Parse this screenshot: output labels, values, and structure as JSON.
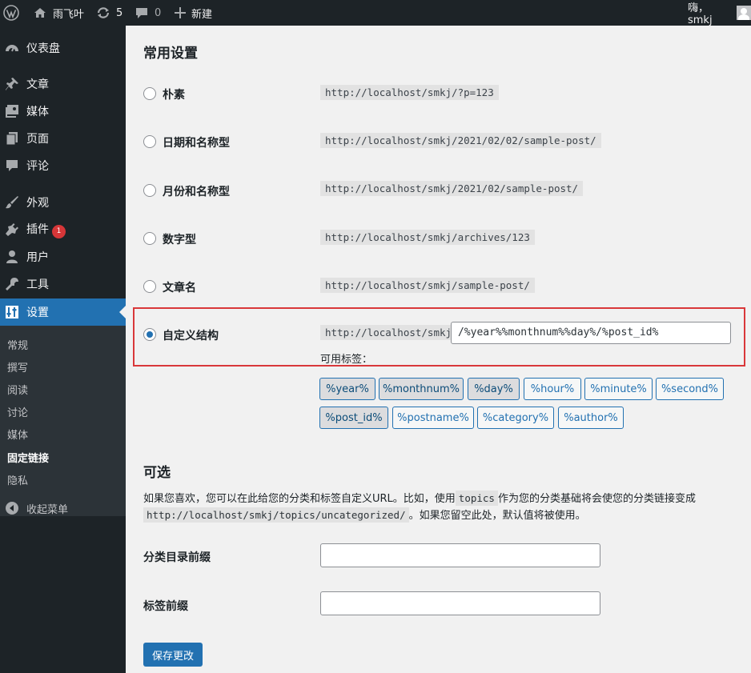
{
  "adminbar": {
    "site_name": "雨飞叶",
    "updates_count": "5",
    "comments_count": "0",
    "new_label": "新建",
    "greeting": "嗨，smkj"
  },
  "sidebar": {
    "items": [
      {
        "label": "仪表盘",
        "icon": "dashboard-icon"
      },
      {
        "label": "文章",
        "icon": "pin-icon"
      },
      {
        "label": "媒体",
        "icon": "media-icon"
      },
      {
        "label": "页面",
        "icon": "page-icon"
      },
      {
        "label": "评论",
        "icon": "comment-icon"
      },
      {
        "label": "外观",
        "icon": "brush-icon"
      },
      {
        "label": "插件",
        "icon": "plugin-icon",
        "badge": "1"
      },
      {
        "label": "用户",
        "icon": "user-icon"
      },
      {
        "label": "工具",
        "icon": "wrench-icon"
      },
      {
        "label": "设置",
        "icon": "settings-icon"
      }
    ],
    "submenu": [
      "常规",
      "撰写",
      "阅读",
      "讨论",
      "媒体",
      "固定链接",
      "隐私"
    ],
    "active_submenu": "固定链接",
    "collapse_label": "收起菜单"
  },
  "common": {
    "heading": "常用设置",
    "options": [
      {
        "label": "朴素",
        "sample": "http://localhost/smkj/?p=123",
        "checked": false
      },
      {
        "label": "日期和名称型",
        "sample": "http://localhost/smkj/2021/02/02/sample-post/",
        "checked": false
      },
      {
        "label": "月份和名称型",
        "sample": "http://localhost/smkj/2021/02/sample-post/",
        "checked": false
      },
      {
        "label": "数字型",
        "sample": "http://localhost/smkj/archives/123",
        "checked": false
      },
      {
        "label": "文章名",
        "sample": "http://localhost/smkj/sample-post/",
        "checked": false
      }
    ],
    "custom": {
      "label": "自定义结构",
      "base": "http://localhost/smkj",
      "value": "/%year%%monthnum%%day%/%post_id%",
      "checked": true,
      "tags_label": "可用标签："
    },
    "tags": [
      {
        "label": "%year%",
        "active": true
      },
      {
        "label": "%monthnum%",
        "active": true
      },
      {
        "label": "%day%",
        "active": true
      },
      {
        "label": "%hour%",
        "active": false
      },
      {
        "label": "%minute%",
        "active": false
      },
      {
        "label": "%second%",
        "active": false
      },
      {
        "label": "%post_id%",
        "active": true
      },
      {
        "label": "%postname%",
        "active": false
      },
      {
        "label": "%category%",
        "active": false
      },
      {
        "label": "%author%",
        "active": false
      }
    ]
  },
  "optional": {
    "heading": "可选",
    "desc_part1": "如果您喜欢，您可以在此给您的分类和标签自定义URL。比如，使用",
    "desc_code1": "topics",
    "desc_part2": "作为您的分类基础将会使您的分类链接变成",
    "desc_code2": "http://localhost/smkj/topics/uncategorized/",
    "desc_part3": "。如果您留空此处，默认值将被使用。",
    "category_label": "分类目录前缀",
    "tag_label": "标签前缀",
    "category_value": "",
    "tag_value": ""
  },
  "save_label": "保存更改",
  "colors": {
    "adminbar": "#1d2327",
    "accent": "#2271b1",
    "highlight": "#d9383a",
    "badge": "#d63638"
  }
}
